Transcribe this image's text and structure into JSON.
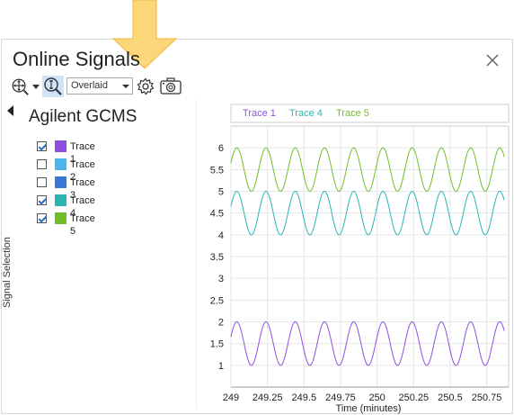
{
  "window": {
    "title": "Online Signals"
  },
  "toolbar": {
    "icons": [
      "pan-zoom-icon",
      "dropdown-caret-icon",
      "zoom-icon",
      "settings-gear-icon",
      "snapshot-camera-icon"
    ],
    "view_mode": "Overlaid"
  },
  "panel": {
    "instrument": "Agilent GCMS",
    "side_label": "Signal Selection",
    "signals": [
      {
        "label": "Trace 1",
        "checked": true,
        "color": "#8e4fe0"
      },
      {
        "label": "Trace 2",
        "checked": false,
        "color": "#4cb6ec"
      },
      {
        "label": "Trace 3",
        "checked": false,
        "color": "#3a78d8"
      },
      {
        "label": "Trace 4",
        "checked": true,
        "color": "#2bb5b3"
      },
      {
        "label": "Trace 5",
        "checked": true,
        "color": "#74bd2a"
      }
    ]
  },
  "chart_data": {
    "type": "line",
    "xlabel": "Time (minutes)",
    "ylabel": "",
    "xlim": [
      249,
      250.9
    ],
    "ylim": [
      0.5,
      6.5
    ],
    "xticks": [
      "249",
      "249.25",
      "249.5",
      "249.75",
      "250",
      "250.25",
      "250.5",
      "250.75"
    ],
    "yticks": [
      "1",
      "1.5",
      "2",
      "2.5",
      "3",
      "3.5",
      "4",
      "4.5",
      "5",
      "5.5",
      "6"
    ],
    "grid": true,
    "legend": "top",
    "series": [
      {
        "name": "Trace 1",
        "color": "#8e4fe0",
        "center": 1.5,
        "amplitude": 0.5,
        "period_min": 0.2,
        "x_start": 249,
        "x_end": 250.87
      },
      {
        "name": "Trace 4",
        "color": "#2bb5b3",
        "center": 4.5,
        "amplitude": 0.5,
        "period_min": 0.2,
        "x_start": 249,
        "x_end": 250.87
      },
      {
        "name": "Trace 5",
        "color": "#74bd2a",
        "center": 5.5,
        "amplitude": 0.5,
        "period_min": 0.2,
        "x_start": 249,
        "x_end": 250.87
      }
    ]
  },
  "colors": {
    "highlight_arrow": "#fbd77a",
    "arrow_stroke": "#f2b63a"
  }
}
